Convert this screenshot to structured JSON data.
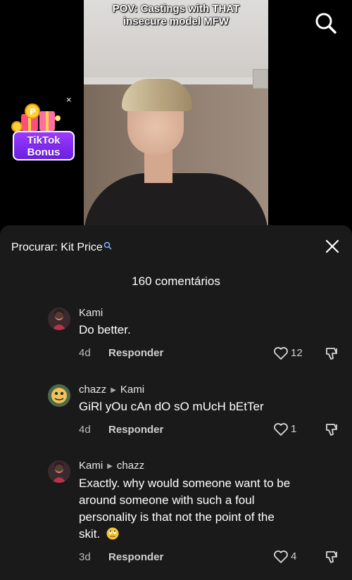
{
  "video": {
    "caption_line1": "POV: Castings with THAT",
    "caption_line2": "insecure model MFW"
  },
  "bonus": {
    "line1": "TikTok",
    "line2": "Bonus",
    "close": "×"
  },
  "sheet": {
    "search_label": "Procurar: Kit Price",
    "comment_count": "160 comentários"
  },
  "comments": [
    {
      "author": "Kami",
      "reply_to": "",
      "text": "Do better.",
      "age": "4d",
      "reply_label": "Responder",
      "likes": "12"
    },
    {
      "author": "chazz",
      "reply_to": "Kami",
      "text": "GiRl yOu cAn dO sO mUcH bEtTer",
      "age": "4d",
      "reply_label": "Responder",
      "likes": "1"
    },
    {
      "author": "Kami",
      "reply_to": "chazz",
      "text_lines": [
        "Exactly. why would someone want to be",
        "around someone with such a foul",
        "personality is that not the point of the",
        "skit."
      ],
      "age": "3d",
      "reply_label": "Responder",
      "likes": "4"
    }
  ],
  "icons": {
    "search": "search-icon",
    "close": "close-icon",
    "like": "heart-icon",
    "dislike": "thumbs-down-icon",
    "emoji": "rolling-eyes-emoji-icon"
  },
  "colors": {
    "sheet_bg": "#1a1a1a",
    "page_bg": "#000000",
    "bonus_purple": "#7b2cf0"
  }
}
